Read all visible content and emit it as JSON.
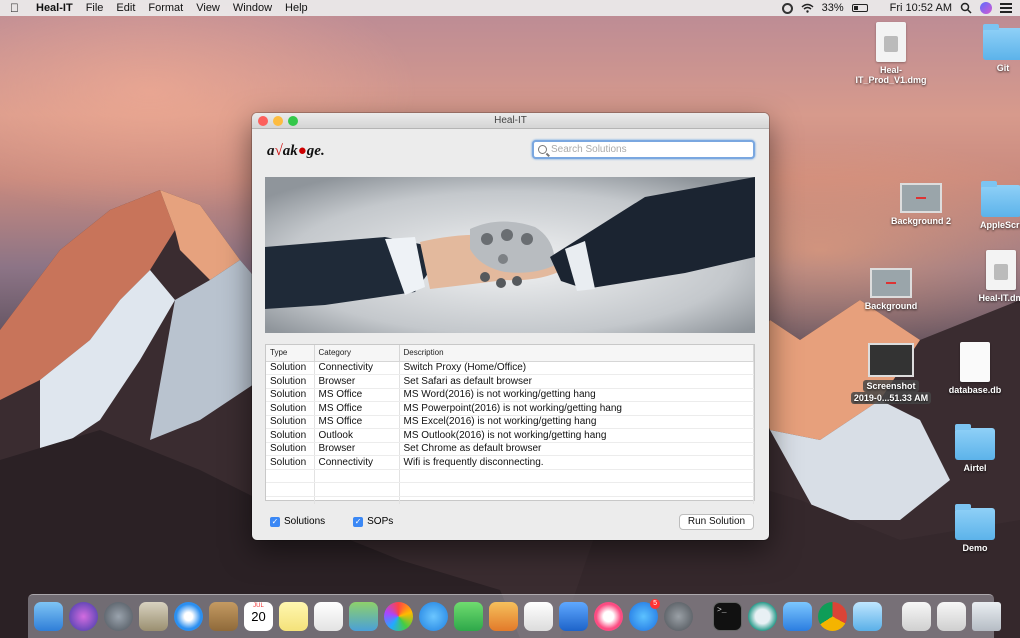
{
  "menubar": {
    "app_name": "Heal-IT",
    "items": [
      "File",
      "Edit",
      "Format",
      "View",
      "Window",
      "Help"
    ],
    "battery": "33%",
    "clock": "Fri 10:52 AM"
  },
  "desktop": {
    "icons": [
      {
        "label": "Heal-\nIT_Prod_V1.dmg",
        "kind": "dmg-icon"
      },
      {
        "label": "Git",
        "kind": "folder-icon"
      },
      {
        "label": "Background 2",
        "kind": "image-icon"
      },
      {
        "label": "AppleScri",
        "kind": "folder-icon"
      },
      {
        "label": "Heal-IT.dm",
        "kind": "dmg-icon"
      },
      {
        "label": "Background",
        "kind": "image-icon"
      },
      {
        "label": "Screenshot",
        "sublabel": "2019-0...51.33 AM",
        "kind": "screenshot-icon"
      },
      {
        "label": "database.db",
        "kind": "document-icon"
      },
      {
        "label": "Airtel",
        "kind": "folder-icon"
      },
      {
        "label": "Demo",
        "kind": "folder-icon"
      }
    ]
  },
  "window": {
    "title": "Heal-IT",
    "logo_text": "avakoge",
    "search_placeholder": "Search Solutions",
    "table": {
      "headers": [
        "Type",
        "Category",
        "Description"
      ],
      "rows": [
        [
          "Solution",
          "Connectivity",
          "Switch Proxy (Home/Office)"
        ],
        [
          "Solution",
          "Browser",
          "Set Safari as default browser"
        ],
        [
          "Solution",
          "MS Office",
          "MS Word(2016) is not working/getting hang"
        ],
        [
          "Solution",
          "MS Office",
          "MS Powerpoint(2016) is not working/getting hang"
        ],
        [
          "Solution",
          "MS Office",
          "MS Excel(2016) is not working/getting hang"
        ],
        [
          "Solution",
          "Outlook",
          "MS Outlook(2016) is not working/getting hang"
        ],
        [
          "Solution",
          "Browser",
          "Set Chrome as default browser"
        ],
        [
          "Solution",
          "Connectivity",
          "Wifi is frequently disconnecting."
        ]
      ]
    },
    "checkbox_solutions": "Solutions",
    "checkbox_sops": "SOPs",
    "run_button": "Run Solution"
  },
  "dock": {
    "calendar_day": "20",
    "calendar_month": "JUL",
    "badge_appstore": "5"
  }
}
